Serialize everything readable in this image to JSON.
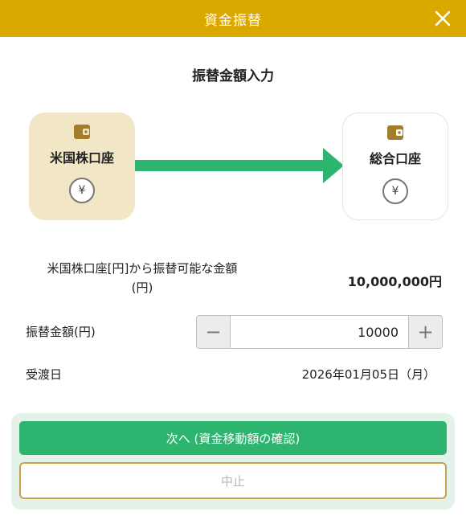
{
  "header": {
    "title": "資金振替",
    "close_icon": "close-icon"
  },
  "section_title": "振替金額入力",
  "from_account": {
    "label": "米国株口座",
    "icon": "wallet-icon",
    "currency_icon": "yen-icon",
    "currency_symbol": "¥"
  },
  "to_account": {
    "label": "総合口座",
    "icon": "wallet-icon",
    "currency_icon": "yen-icon",
    "currency_symbol": "¥"
  },
  "available": {
    "label_line1": "米国株口座[円]から振替可能な金額",
    "label_line2": "(円)",
    "value": "10,000,000円"
  },
  "amount": {
    "label": "振替金額(円)",
    "value": "10000",
    "minus": "−",
    "plus": "+"
  },
  "settlement": {
    "label": "受渡日",
    "value": "2026年01月05日（月）"
  },
  "buttons": {
    "next": "次へ (資金移動額の確認)",
    "cancel": "中止"
  },
  "colors": {
    "header": "#dba800",
    "accent_green": "#2db56f",
    "from_card": "#f1e6c6",
    "footer_bg": "#e3f3ea",
    "cancel_border": "#c9a14a"
  }
}
